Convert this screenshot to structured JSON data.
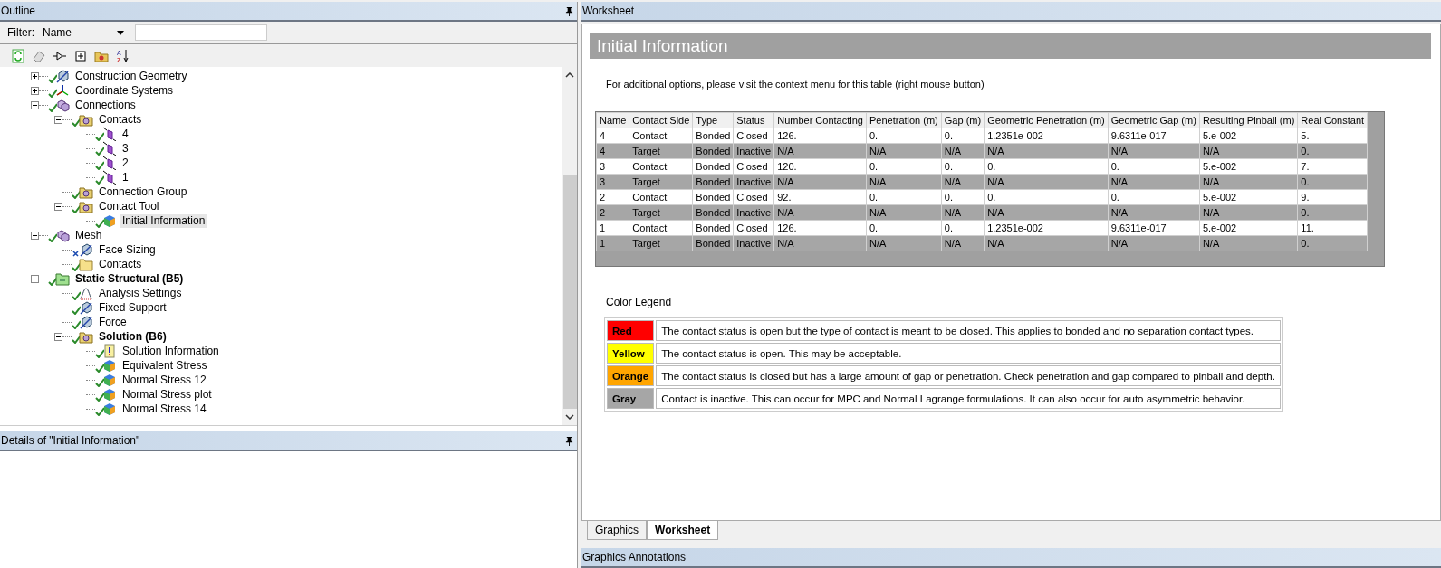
{
  "outline": {
    "title": "Outline",
    "filter": {
      "label": "Filter:",
      "value": "Name"
    },
    "tree": [
      {
        "label": "Construction Geometry",
        "kind": "geometry",
        "check": true,
        "expanded": false,
        "selected": false,
        "emphasized": false
      },
      {
        "label": "Coordinate Systems",
        "kind": "axes",
        "check": true,
        "expanded": false,
        "selected": false,
        "emphasized": false
      },
      {
        "label": "Connections",
        "kind": "connections",
        "check": true,
        "expanded": true,
        "selected": false,
        "emphasized": false,
        "children": [
          {
            "label": "Contacts",
            "kind": "contact-folder",
            "check": true,
            "expanded": true,
            "selected": false,
            "emphasized": false,
            "children": [
              {
                "label": "4",
                "kind": "contact-region",
                "check": true,
                "selected": false,
                "emphasized": false
              },
              {
                "label": "3",
                "kind": "contact-region",
                "check": true,
                "selected": false,
                "emphasized": false
              },
              {
                "label": "2",
                "kind": "contact-region",
                "check": true,
                "selected": false,
                "emphasized": false
              },
              {
                "label": "1",
                "kind": "contact-region",
                "check": true,
                "selected": false,
                "emphasized": false
              }
            ]
          },
          {
            "label": "Connection Group",
            "kind": "contact-folder",
            "check": true,
            "selected": false,
            "emphasized": false
          },
          {
            "label": "Contact Tool",
            "kind": "contact-folder",
            "check": true,
            "expanded": true,
            "selected": false,
            "emphasized": false,
            "children": [
              {
                "label": "Initial Information",
                "kind": "result",
                "check": true,
                "selected": true,
                "emphasized": false
              }
            ]
          }
        ]
      },
      {
        "label": "Mesh",
        "kind": "connections",
        "check": true,
        "expanded": true,
        "selected": false,
        "emphasized": false,
        "children": [
          {
            "label": "Face Sizing",
            "kind": "geometry",
            "check": false,
            "selected": false,
            "emphasized": false
          },
          {
            "label": "Contacts",
            "kind": "folder",
            "check": true,
            "selected": false,
            "emphasized": false
          }
        ]
      },
      {
        "label": "Static Structural (B5)",
        "kind": "analysis",
        "check": true,
        "expanded": true,
        "selected": false,
        "emphasized": true,
        "children": [
          {
            "label": "Analysis Settings",
            "kind": "settings",
            "check": true,
            "selected": false,
            "emphasized": false
          },
          {
            "label": "Fixed Support",
            "kind": "geometry",
            "check": true,
            "selected": false,
            "emphasized": false
          },
          {
            "label": "Force",
            "kind": "geometry",
            "check": true,
            "selected": false,
            "emphasized": false
          },
          {
            "label": "Solution (B6)",
            "kind": "contact-folder",
            "check": true,
            "expanded": true,
            "selected": false,
            "emphasized": true,
            "children": [
              {
                "label": "Solution Information",
                "kind": "info",
                "check": true,
                "selected": false,
                "emphasized": false
              },
              {
                "label": "Equivalent Stress",
                "kind": "result",
                "check": true,
                "selected": false,
                "emphasized": false
              },
              {
                "label": "Normal Stress 12",
                "kind": "result",
                "check": true,
                "selected": false,
                "emphasized": false
              },
              {
                "label": "Normal Stress plot",
                "kind": "result",
                "check": true,
                "selected": false,
                "emphasized": false
              },
              {
                "label": "Normal Stress 14",
                "kind": "result",
                "check": true,
                "selected": false,
                "emphasized": false
              }
            ]
          }
        ]
      }
    ]
  },
  "details": {
    "title": "Details of \"Initial Information\""
  },
  "sort_icon_letters": [
    "A",
    "Z"
  ],
  "worksheet": {
    "title": "Worksheet",
    "banner": "Initial Information",
    "note": "For additional options, please visit the context menu for this table (right mouse button)",
    "table": {
      "columns": [
        "Name",
        "Contact Side",
        "Type",
        "Status",
        "Number Contacting",
        "Penetration (m)",
        "Gap (m)",
        "Geometric Penetration (m)",
        "Geometric Gap (m)",
        "Resulting Pinball (m)",
        "Real Constant"
      ],
      "rows": [
        {
          "color": "#ffffff",
          "cells": [
            "4",
            "Contact",
            "Bonded",
            "Closed",
            "126.",
            "0.",
            "0.",
            "1.2351e-002",
            "9.6311e-017",
            "5.e-002",
            "5."
          ]
        },
        {
          "color": "#a6a6a6",
          "cells": [
            "4",
            "Target",
            "Bonded",
            "Inactive",
            "N/A",
            "N/A",
            "N/A",
            "N/A",
            "N/A",
            "N/A",
            "0."
          ]
        },
        {
          "color": "#ffffff",
          "cells": [
            "3",
            "Contact",
            "Bonded",
            "Closed",
            "120.",
            "0.",
            "0.",
            "0.",
            "0.",
            "5.e-002",
            "7."
          ]
        },
        {
          "color": "#a6a6a6",
          "cells": [
            "3",
            "Target",
            "Bonded",
            "Inactive",
            "N/A",
            "N/A",
            "N/A",
            "N/A",
            "N/A",
            "N/A",
            "0."
          ]
        },
        {
          "color": "#ffffff",
          "cells": [
            "2",
            "Contact",
            "Bonded",
            "Closed",
            "92.",
            "0.",
            "0.",
            "0.",
            "0.",
            "5.e-002",
            "9."
          ]
        },
        {
          "color": "#a6a6a6",
          "cells": [
            "2",
            "Target",
            "Bonded",
            "Inactive",
            "N/A",
            "N/A",
            "N/A",
            "N/A",
            "N/A",
            "N/A",
            "0."
          ]
        },
        {
          "color": "#ffffff",
          "cells": [
            "1",
            "Contact",
            "Bonded",
            "Closed",
            "126.",
            "0.",
            "0.",
            "1.2351e-002",
            "9.6311e-017",
            "5.e-002",
            "11."
          ]
        },
        {
          "color": "#a6a6a6",
          "cells": [
            "1",
            "Target",
            "Bonded",
            "Inactive",
            "N/A",
            "N/A",
            "N/A",
            "N/A",
            "N/A",
            "N/A",
            "0."
          ]
        }
      ]
    },
    "legend": {
      "title": "Color Legend",
      "items": [
        {
          "label": "Red",
          "color": "#ff0000",
          "text": "The contact status is open but the type of contact is meant to be closed. This applies to bonded and no separation contact types."
        },
        {
          "label": "Yellow",
          "color": "#ffff00",
          "text": "The contact status is open. This may be acceptable."
        },
        {
          "label": "Orange",
          "color": "#ffa500",
          "text": "The contact status is closed but has a large amount of gap or penetration. Check penetration and gap compared to pinball and depth."
        },
        {
          "label": "Gray",
          "color": "#a6a6a6",
          "text": "Contact is inactive. This can occur for MPC and Normal Lagrange formulations. It can also occur for auto asymmetric behavior."
        }
      ]
    },
    "tabs": [
      {
        "label": "Graphics",
        "selected": false
      },
      {
        "label": "Worksheet",
        "selected": true
      }
    ]
  },
  "annotations": {
    "title": "Graphics Annotations"
  }
}
